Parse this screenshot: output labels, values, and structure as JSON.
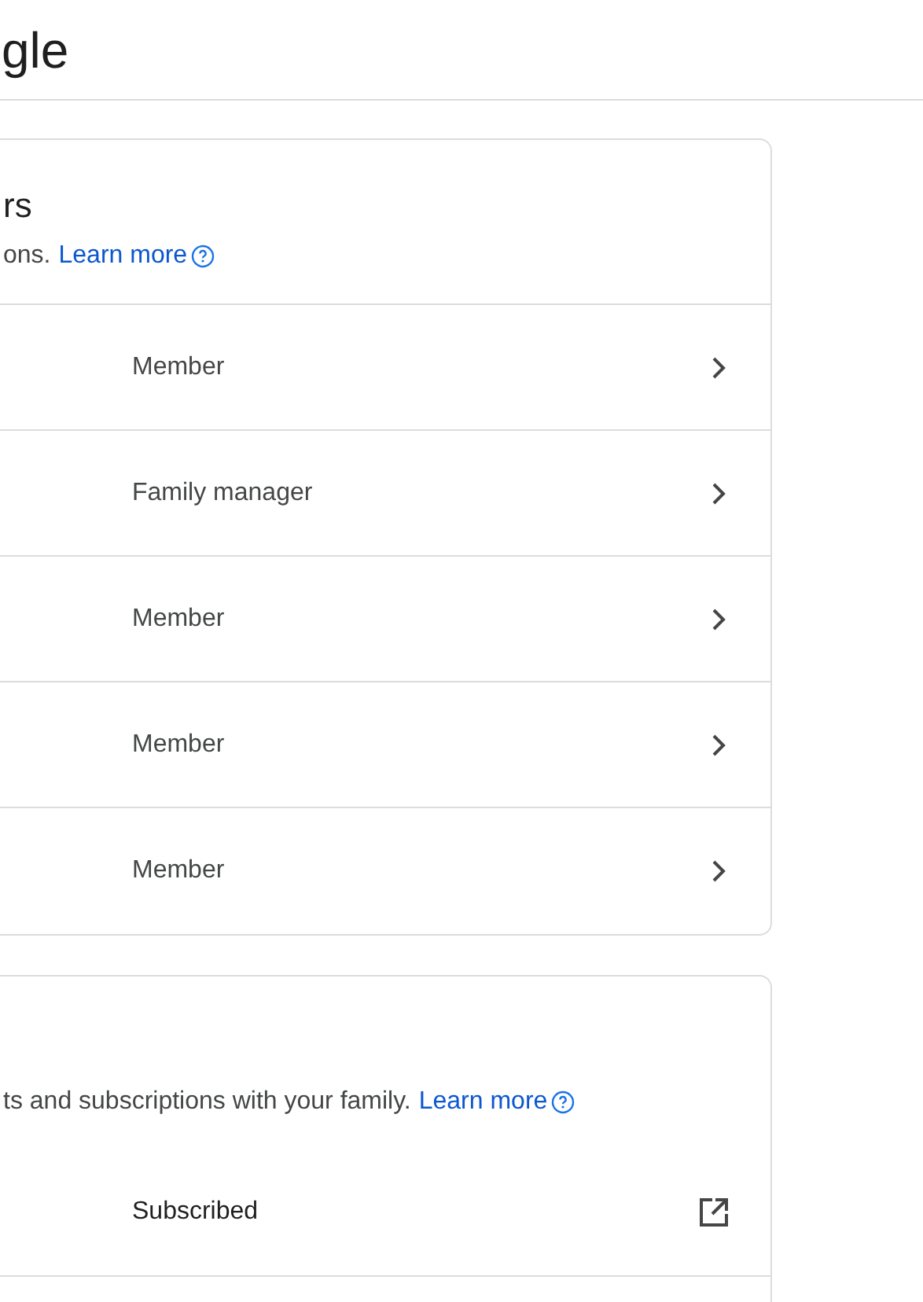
{
  "header": {
    "title": "gle"
  },
  "members_card": {
    "title": "rs",
    "description": "ons.",
    "link": "Learn more",
    "rows": [
      {
        "role": "Member",
        "kind": "chevron"
      },
      {
        "role": "Family manager",
        "kind": "chevron"
      },
      {
        "role": "Member",
        "kind": "chevron"
      },
      {
        "role": "Member",
        "kind": "chevron"
      },
      {
        "role": "Member",
        "kind": "chevron"
      }
    ]
  },
  "services_card": {
    "description": "ts and subscriptions with your family.",
    "link": "Learn more",
    "rows": [
      {
        "role": "Subscribed",
        "kind": "external"
      }
    ]
  }
}
